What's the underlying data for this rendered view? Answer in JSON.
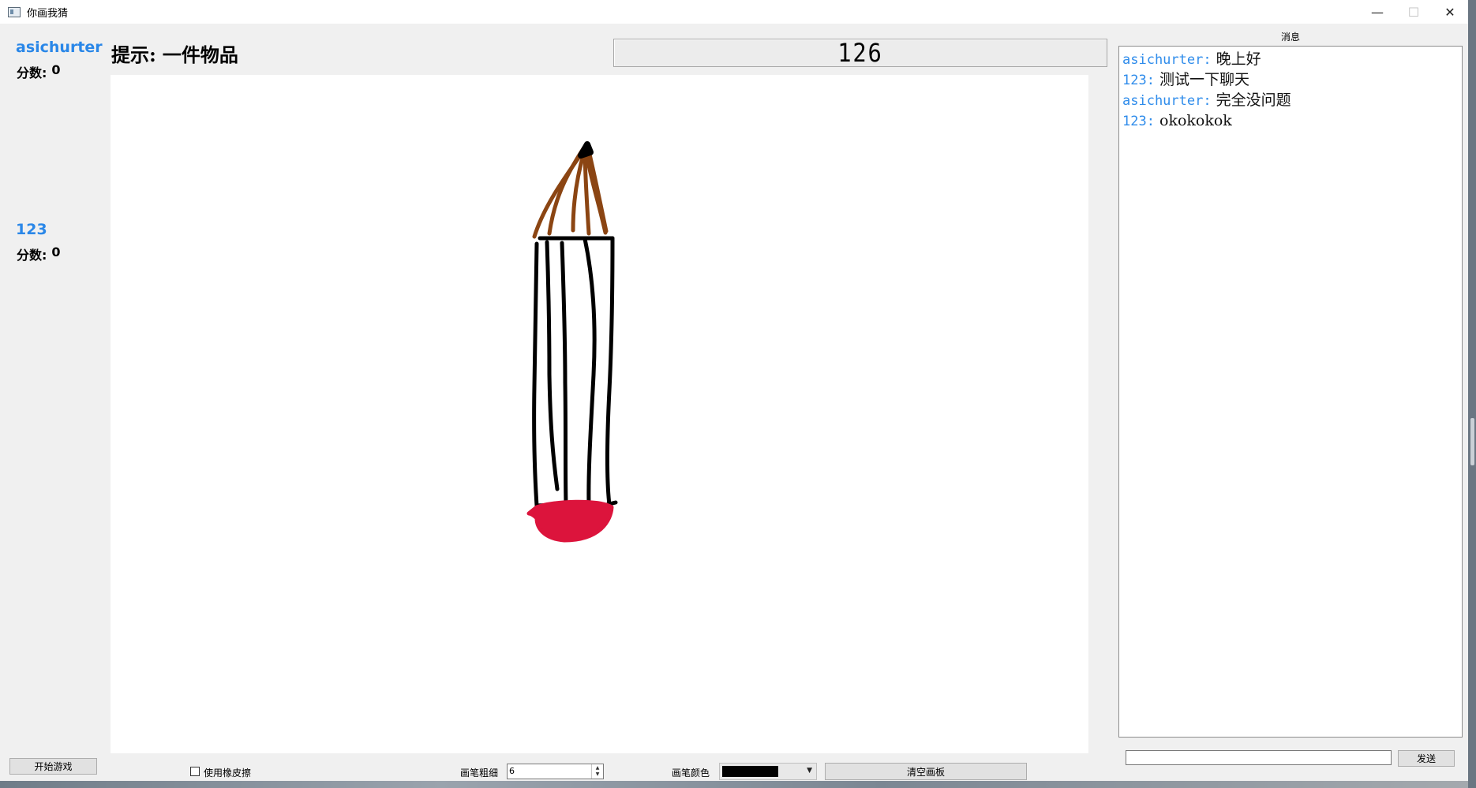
{
  "window": {
    "title": "你画我猜"
  },
  "players": [
    {
      "name": "asichurter",
      "score_label": "分数:",
      "score": "0"
    },
    {
      "name": "123",
      "score_label": "分数:",
      "score": "0"
    }
  ],
  "hint": {
    "label": "提示:",
    "value": "一件物品"
  },
  "timer": {
    "value": "126"
  },
  "chat": {
    "header": "消息",
    "messages": [
      {
        "sender": "asichurter:",
        "text": "晚上好"
      },
      {
        "sender": "123:",
        "text": "测试一下聊天"
      },
      {
        "sender": "asichurter:",
        "text": "完全没问题"
      },
      {
        "sender": "123:",
        "text": "okokokok"
      }
    ],
    "input_value": "",
    "send_label": "发送"
  },
  "controls": {
    "start_label": "开始游戏",
    "eraser_label": "使用橡皮擦",
    "eraser_checked": false,
    "pen_size_label": "画笔粗细",
    "pen_size_value": "6",
    "pen_color_label": "画笔颜色",
    "pen_color": "#000000",
    "clear_label": "清空画板"
  },
  "colors": {
    "accent_name": "#2a87e8",
    "drawing_black": "#000000",
    "drawing_brown": "#8b4513",
    "drawing_red": "#dc143c"
  }
}
